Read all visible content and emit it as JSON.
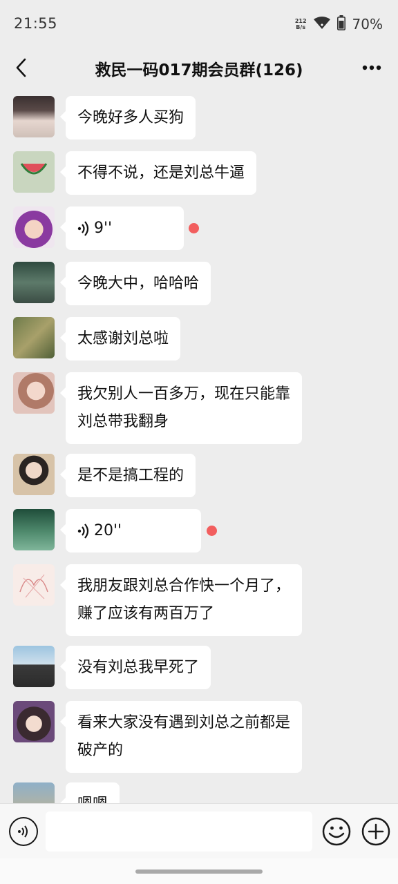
{
  "status": {
    "time": "21:55",
    "net_speed_value": "212",
    "net_speed_unit": "B/s",
    "battery": "70%"
  },
  "header": {
    "title": "救民一码017期会员群(126)",
    "back_icon": "chevron-left-icon",
    "more_icon": "more-dots-icon"
  },
  "messages": [
    {
      "type": "text",
      "text": "今晚好多人买狗"
    },
    {
      "type": "text",
      "text": "不得不说，还是刘总牛逼"
    },
    {
      "type": "voice",
      "duration": "9''",
      "unread": true
    },
    {
      "type": "text",
      "text": "今晚大中，哈哈哈"
    },
    {
      "type": "text",
      "text": "太感谢刘总啦"
    },
    {
      "type": "text",
      "line1": "我欠别人一百多万，现在只能靠",
      "line2": "刘总带我翻身"
    },
    {
      "type": "text",
      "text": "是不是搞工程的"
    },
    {
      "type": "voice",
      "duration": "20''",
      "unread": true
    },
    {
      "type": "text",
      "line1": "我朋友跟刘总合作快一个月了，",
      "line2": "赚了应该有两百万了"
    },
    {
      "type": "text",
      "text": "没有刘总我早死了"
    },
    {
      "type": "text",
      "line1": "看来大家没有遇到刘总之前都是",
      "line2": "破产的"
    },
    {
      "type": "text",
      "text": "嗯嗯"
    }
  ],
  "input": {
    "placeholder": "",
    "voice_icon": "voice-icon",
    "emoji_icon": "emoji-icon",
    "plus_icon": "plus-icon"
  },
  "colors": {
    "background": "#ededed",
    "bubble": "#ffffff",
    "unread_dot": "#f25e5e"
  }
}
